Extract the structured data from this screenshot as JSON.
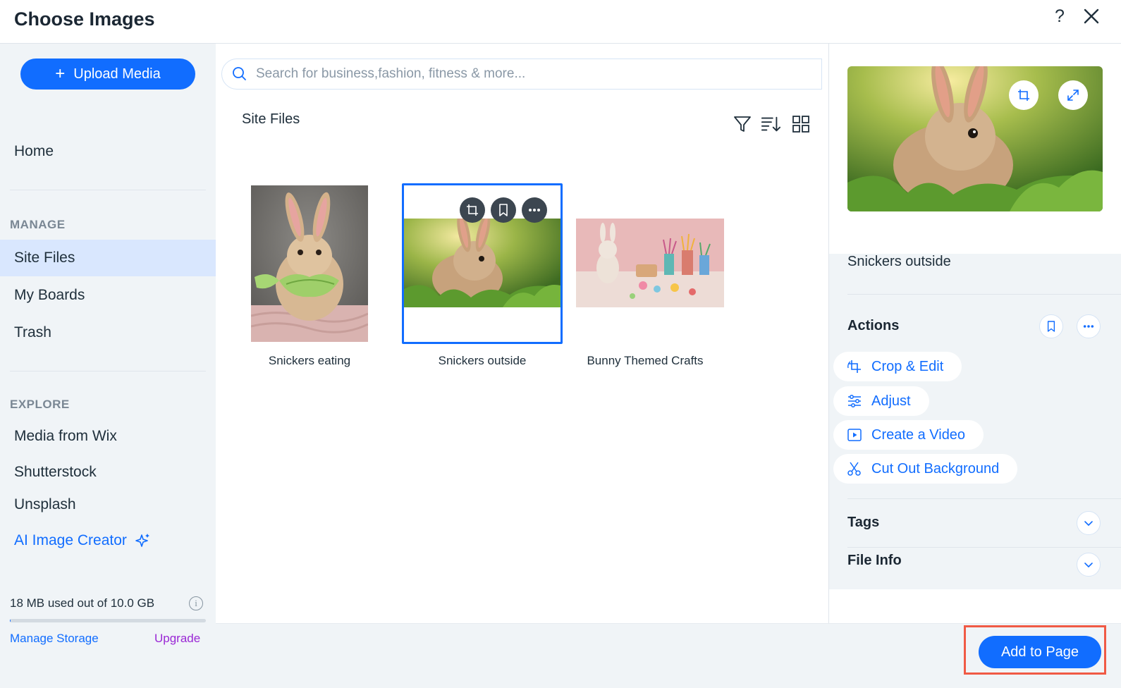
{
  "header": {
    "title": "Choose Images",
    "help_label": "?"
  },
  "sidebar": {
    "upload_label": "Upload Media",
    "home_label": "Home",
    "manage_section": "MANAGE",
    "manage_items": [
      "Site Files",
      "My Boards",
      "Trash"
    ],
    "active_item": "Site Files",
    "explore_section": "EXPLORE",
    "explore_items": [
      "Media from Wix",
      "Shutterstock",
      "Unsplash"
    ],
    "ai_item": "AI Image Creator",
    "storage": {
      "text": "18 MB used out of 10.0 GB",
      "used_fraction": 0.002,
      "manage_label": "Manage Storage",
      "upgrade_label": "Upgrade"
    }
  },
  "main": {
    "search_placeholder": "Search for business,fashion, fitness & more...",
    "section_title": "Site Files",
    "tools": [
      "filter-icon",
      "sort-icon",
      "grid-view-icon"
    ],
    "files": [
      {
        "name": "Snickers eating",
        "selected": false
      },
      {
        "name": "Snickers outside",
        "selected": true
      },
      {
        "name": "Bunny Themed Crafts",
        "selected": false
      }
    ]
  },
  "panel": {
    "file_name": "Snickers outside",
    "actions_heading": "Actions",
    "actions": [
      "Crop & Edit",
      "Adjust",
      "Create a Video",
      "Cut Out Background"
    ],
    "tags_heading": "Tags",
    "file_info_heading": "File Info"
  },
  "footer": {
    "add_label": "Add to Page"
  },
  "colors": {
    "accent": "#116dff",
    "sidebar_bg": "#f0f4f7",
    "active_bg": "#d9e7fe",
    "upgrade": "#9a27d5",
    "highlight": "#f05a45"
  }
}
